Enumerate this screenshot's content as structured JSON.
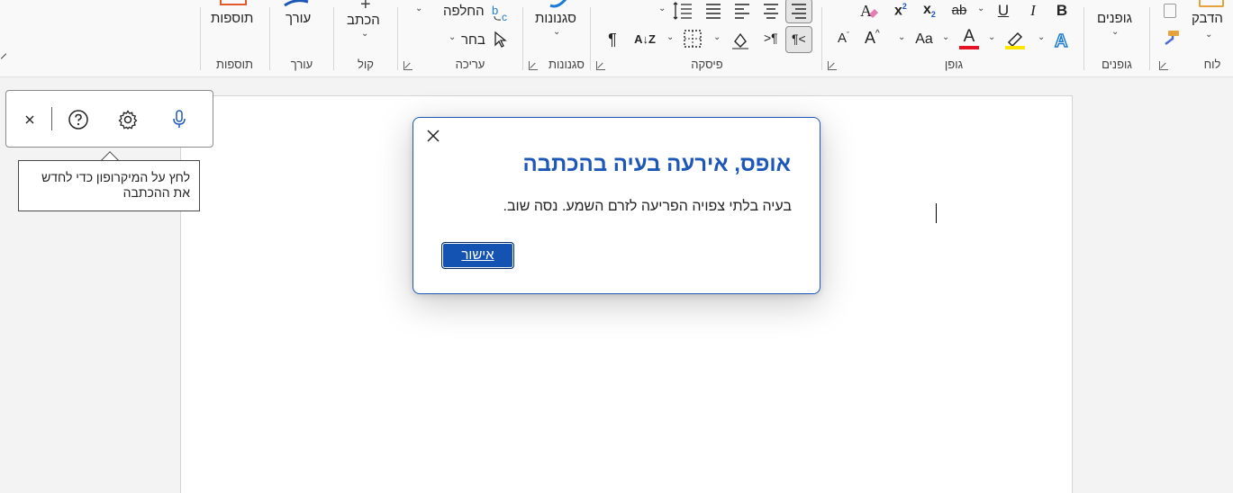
{
  "ribbon": {
    "groups": {
      "clipboard": {
        "label": "לוח",
        "paste_label": "הדבק"
      },
      "styles_gallery": {
        "label": "גופנים",
        "button_label": "גופנים"
      },
      "font": {
        "label": "גופן"
      },
      "paragraph": {
        "label": "פיסקה"
      },
      "styles": {
        "label": "סגנונות",
        "button_label": "סגנונות"
      },
      "editing": {
        "label": "עריכה",
        "replace_label": "החלפה",
        "select_label": "בחר"
      },
      "voice": {
        "label": "קול",
        "dictate_label": "הכתב"
      },
      "editor": {
        "label": "עורך",
        "button_label": "עורך"
      },
      "addins": {
        "label": "תוספות",
        "button_label": "תוספות"
      }
    },
    "font_tools": {
      "bold": "B",
      "italic": "I",
      "underline": "U",
      "strike": "ab",
      "subscript": "x",
      "subscript_mark": "2",
      "superscript": "x",
      "superscript_mark": "2",
      "change_case": "Aa",
      "grow": "A",
      "shrink": "A",
      "text_effects": "A",
      "font_color": "A",
      "font_color_hex": "#e81123",
      "highlight_hex": "#ffe600"
    },
    "paragraph_tools": {
      "pilcrow": "¶",
      "sort": "A↓Z"
    }
  },
  "dictation": {
    "tooltip": "לחץ על המיקרופון כדי לחדש את ההכתבה",
    "icons": [
      "microphone-icon",
      "settings-icon",
      "help-icon",
      "close-icon"
    ]
  },
  "dialog": {
    "title": "אופס, אירעה בעיה בהכתבה",
    "message": "בעיה בלתי צפויה הפריעה לזרם השמע. נסה שוב.",
    "ok_label": "אישור"
  },
  "colors": {
    "accent": "#1d57b8",
    "ok_button": "#1553b3",
    "mic": "#1d57b8"
  }
}
